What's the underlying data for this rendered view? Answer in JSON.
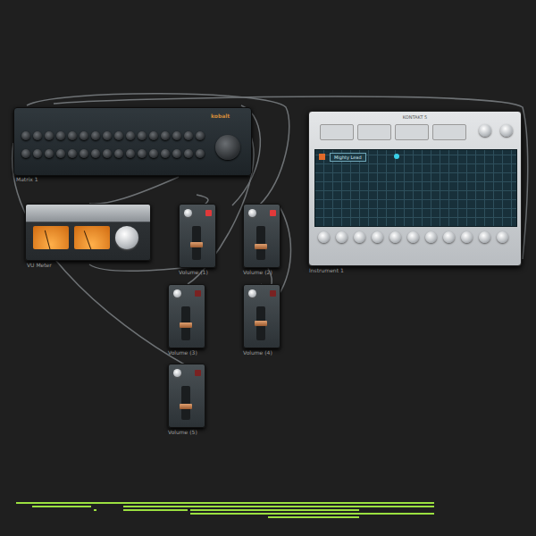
{
  "sequencer": {
    "brand": "kobalt",
    "label": "Matrix 1"
  },
  "vu_meter": {
    "label": "VU Meter",
    "meters": [
      {
        "level": 0.35
      },
      {
        "level": 0.3
      }
    ]
  },
  "faders": [
    {
      "label": "Volume (1)",
      "level": 0.45,
      "on": true
    },
    {
      "label": "Volume (2)",
      "level": 0.4,
      "on": true
    },
    {
      "label": "Volume (3)",
      "level": 0.45,
      "on": false
    },
    {
      "label": "Volume (4)",
      "level": 0.5,
      "on": false
    },
    {
      "label": "Volume (5)",
      "level": 0.4,
      "on": false
    }
  ],
  "sampler": {
    "title": "KONTAKT 5",
    "preset": "Mighty Lead",
    "label": "Instrument 1"
  },
  "piano_roll": {
    "notes": [
      {
        "row": 0,
        "start": 3,
        "end": 81
      },
      {
        "row": 1,
        "start": 6,
        "end": 17
      },
      {
        "row": 1,
        "start": 23,
        "end": 81
      },
      {
        "row": 2,
        "start": 17.5,
        "end": 18
      },
      {
        "row": 2,
        "start": 23,
        "end": 35
      },
      {
        "row": 2,
        "start": 35.5,
        "end": 67
      },
      {
        "row": 3,
        "start": 35.5,
        "end": 81
      },
      {
        "row": 4,
        "start": 50,
        "end": 67
      }
    ]
  }
}
